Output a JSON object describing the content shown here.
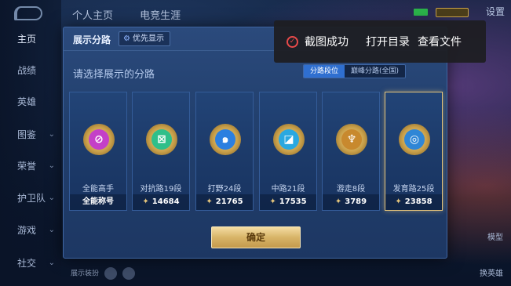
{
  "background": {
    "top_tabs": [
      "个人主页",
      "电竞生涯"
    ],
    "top_right_label": "设置",
    "sidebar": [
      {
        "label": "主页",
        "chevron": false
      },
      {
        "label": "战绩",
        "chevron": false
      },
      {
        "label": "英雄",
        "chevron": false
      },
      {
        "label": "图鉴",
        "chevron": true
      },
      {
        "label": "荣誉",
        "chevron": true
      },
      {
        "label": "护卫队",
        "chevron": true
      },
      {
        "label": "游戏",
        "chevron": true
      },
      {
        "label": "社交",
        "chevron": true
      }
    ],
    "bottom_hint": "展示装扮",
    "right_labels": [
      "模型",
      "换英雄"
    ]
  },
  "modal": {
    "title": "展示分路",
    "priority_button": "优先显示",
    "subtitle": "请选择展示的分路",
    "segment": {
      "active": "分路段位",
      "inactive": "巅峰分路(全国)"
    },
    "cards": [
      {
        "label": "全能高手",
        "score": "全能称号",
        "has_score_icon": false,
        "emblem_color": "#c440c8",
        "glyph": "⊘",
        "selected": false
      },
      {
        "label": "对抗路19段",
        "score": "14684",
        "has_score_icon": true,
        "emblem_color": "#2fbf8a",
        "glyph": "⊠",
        "selected": false
      },
      {
        "label": "打野24段",
        "score": "21765",
        "has_score_icon": true,
        "emblem_color": "#2b7fe0",
        "glyph": "๑",
        "selected": false
      },
      {
        "label": "中路21段",
        "score": "17535",
        "has_score_icon": true,
        "emblem_color": "#2aa8e0",
        "glyph": "◪",
        "selected": false
      },
      {
        "label": "游走8段",
        "score": "3789",
        "has_score_icon": true,
        "emblem_color": "#c8892e",
        "glyph": "♆",
        "selected": false
      },
      {
        "label": "发育路25段",
        "score": "23858",
        "has_score_icon": true,
        "emblem_color": "#2f86d6",
        "glyph": "◎",
        "selected": true
      }
    ],
    "confirm_label": "确定"
  },
  "toast": {
    "message": "截图成功",
    "action_open_dir": "打开目录",
    "action_view_file": "查看文件"
  }
}
